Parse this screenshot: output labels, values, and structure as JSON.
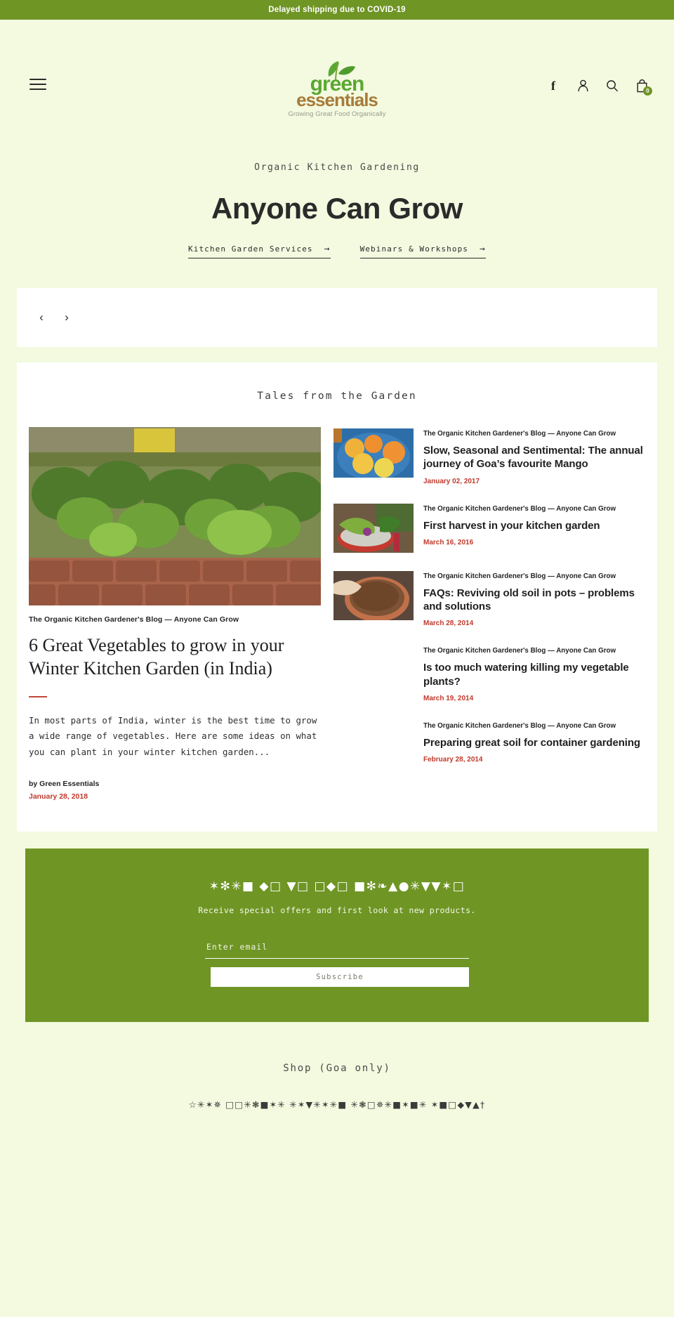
{
  "announcement": {
    "text": "Delayed shipping due to COVID-19",
    "bg": "#6f9524"
  },
  "header": {
    "menu_icon": "hamburger-icon",
    "logo": {
      "word_green": "green",
      "word_essentials": "essentials",
      "tagline": "Growing Great Food Organically"
    },
    "icons": {
      "facebook": "f",
      "account": "account-icon",
      "search": "search-icon",
      "cart": "cart-icon",
      "cart_count": "0"
    }
  },
  "hero": {
    "eyebrow": "Organic Kitchen Gardening",
    "title": "Anyone Can Grow",
    "links": [
      {
        "label": "Kitchen Garden Services",
        "arrow": "→"
      },
      {
        "label": "Webinars & Workshops",
        "arrow": "→"
      }
    ]
  },
  "carousel": {
    "prev": "‹",
    "next": "›"
  },
  "blog": {
    "section_title": "Tales from the Garden",
    "feature": {
      "kicker": "The Organic Kitchen Gardener's Blog — Anyone Can Grow",
      "title": "6 Great Vegetables to grow in your Winter Kitchen Garden (in India)",
      "excerpt": "In most parts of India, winter is the best time to grow a wide range of vegetables. Here are some ideas on what you can plant in your winter kitchen garden...",
      "author": "by Green Essentials",
      "date": "January 28, 2018",
      "image_alt": "raised-garden-bed-photo"
    },
    "sidebar": [
      {
        "kicker": "The Organic Kitchen Gardener's Blog — Anyone Can Grow",
        "title": "Slow, Seasonal and Sentimental: The annual journey of Goa’s favourite Mango",
        "date": "January 02, 2017",
        "image_alt": "bowl-of-mangoes-photo",
        "has_image": true
      },
      {
        "kicker": "The Organic Kitchen Gardener's Blog — Anyone Can Grow",
        "title": "First harvest in your kitchen garden",
        "date": "March 16, 2016",
        "image_alt": "harvested-vegetables-photo",
        "has_image": true
      },
      {
        "kicker": "The Organic Kitchen Gardener's Blog — Anyone Can Grow",
        "title": "FAQs: Reviving old soil in pots – problems and solutions",
        "date": "March 28, 2014",
        "image_alt": "pot-of-soil-photo",
        "has_image": true
      },
      {
        "kicker": "The Organic Kitchen Gardener's Blog — Anyone Can Grow",
        "title": "Is too much watering killing my vegetable plants?",
        "date": "March 19, 2014",
        "image_alt": "",
        "has_image": false
      },
      {
        "kicker": "The Organic Kitchen Gardener's Blog — Anyone Can Grow",
        "title": "Preparing great soil for container gardening",
        "date": "February 28, 2014",
        "image_alt": "",
        "has_image": false
      }
    ]
  },
  "newsletter": {
    "title": "✶✻✳■ ◆□ ▼□ □◆□ ■✻❧▲●✳▼▼✶□",
    "subtitle": "Receive special offers and  first look at new products.",
    "email_placeholder": "Enter email",
    "email_value": "",
    "button_label": "Subscribe",
    "bg": "#6f9524"
  },
  "footer": {
    "title": "Shop (Goa only)",
    "links_text": "☆✳✶✵ □□✳❃■✶✳ ✳✶▼✳✶✳■ ✳❃□✵✳■✶■✳ ✶■□◆▼▲†"
  }
}
